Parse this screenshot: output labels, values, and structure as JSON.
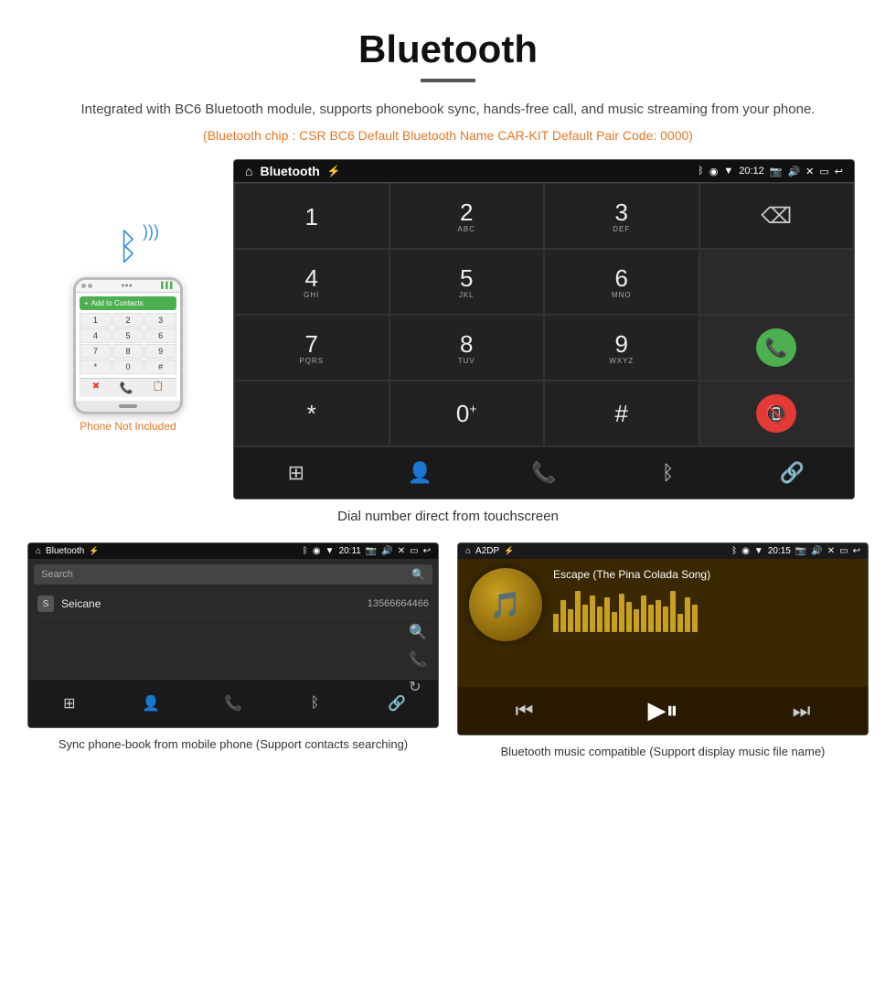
{
  "page": {
    "title": "Bluetooth",
    "description": "Integrated with BC6 Bluetooth module, supports phonebook sync, hands-free call, and music streaming from your phone.",
    "specs": "(Bluetooth chip : CSR BC6    Default Bluetooth Name CAR-KIT    Default Pair Code: 0000)",
    "dial_caption": "Dial number direct from touchscreen",
    "phonebook_caption": "Sync phone-book from mobile phone\n(Support contacts searching)",
    "music_caption": "Bluetooth music compatible\n(Support display music file name)",
    "phone_not_included": "Phone Not Included"
  },
  "dial_screen": {
    "status_time": "20:12",
    "screen_title": "Bluetooth",
    "keys": [
      {
        "main": "1",
        "sub": ""
      },
      {
        "main": "2",
        "sub": "ABC"
      },
      {
        "main": "3",
        "sub": "DEF"
      },
      {
        "main": "",
        "sub": "",
        "type": "empty"
      },
      {
        "main": "4",
        "sub": "GHI"
      },
      {
        "main": "5",
        "sub": "JKL"
      },
      {
        "main": "6",
        "sub": "MNO"
      },
      {
        "main": "",
        "sub": "",
        "type": "empty"
      },
      {
        "main": "7",
        "sub": "PQRS"
      },
      {
        "main": "8",
        "sub": "TUV"
      },
      {
        "main": "9",
        "sub": "WXYZ"
      },
      {
        "main": "",
        "sub": "",
        "type": "refresh"
      },
      {
        "main": "*",
        "sub": ""
      },
      {
        "main": "0",
        "sub": "+"
      },
      {
        "main": "#",
        "sub": ""
      },
      {
        "main": "",
        "sub": "",
        "type": "empty"
      }
    ],
    "last_row_right": [
      "call_green",
      "call_red"
    ],
    "nav_icons": [
      "grid",
      "person",
      "phone",
      "bluetooth",
      "link"
    ]
  },
  "phonebook_screen": {
    "status_time": "20:11",
    "screen_title": "Bluetooth",
    "search_placeholder": "Search",
    "contact_letter": "S",
    "contact_name": "Seicane",
    "contact_phone": "13566664466"
  },
  "music_screen": {
    "status_time": "20:15",
    "screen_title": "A2DP",
    "song_title": "Escape (The Pina Colada Song)",
    "eq_bars": [
      20,
      35,
      25,
      45,
      30,
      40,
      28,
      38,
      22,
      42,
      33,
      25,
      40,
      30,
      35,
      28,
      45,
      20,
      38,
      30
    ]
  }
}
